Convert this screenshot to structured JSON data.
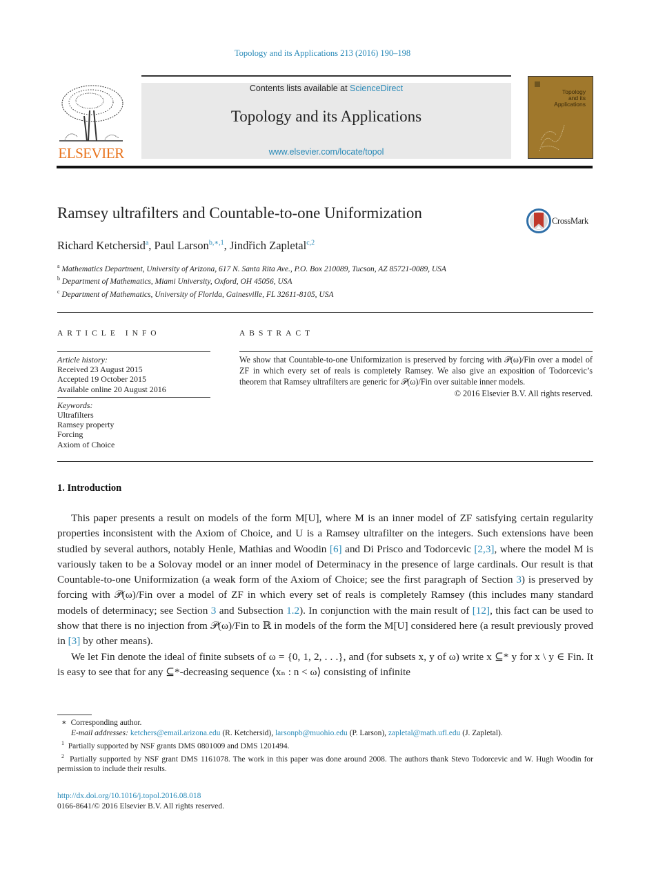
{
  "header": {
    "journal_ref": "Topology and its Applications 213 (2016) 190–198",
    "contents_prefix": "Contents lists available at ",
    "contents_link": "ScienceDirect",
    "journal_name": "Topology and its Applications",
    "journal_url": "www.elsevier.com/locate/topol",
    "publisher_logo": "ELSEVIER",
    "cover_title_lines": [
      "Topology",
      "and its",
      "Applications"
    ]
  },
  "article": {
    "title": "Ramsey ultrafilters and Countable-to-one Uniformization",
    "crossmark_label": "CrossMark",
    "authors": [
      {
        "name": "Richard Ketchersid",
        "marks": "a"
      },
      {
        "name": "Paul Larson",
        "marks": "b,∗,1"
      },
      {
        "name": "Jindřich Zapletal",
        "marks": "c,2"
      }
    ],
    "affiliations": [
      {
        "mark": "a",
        "text": "Mathematics Department, University of Arizona, 617 N. Santa Rita Ave., P.O. Box 210089, Tucson, AZ 85721-0089, USA"
      },
      {
        "mark": "b",
        "text": "Department of Mathematics, Miami University, Oxford, OH 45056, USA"
      },
      {
        "mark": "c",
        "text": "Department of Mathematics, University of Florida, Gainesville, FL 32611-8105, USA"
      }
    ]
  },
  "article_info": {
    "heading": "ARTICLE INFO",
    "history_label": "Article history:",
    "history": [
      "Received 23 August 2015",
      "Accepted 19 October 2015",
      "Available online 20 August 2016"
    ],
    "keywords_label": "Keywords:",
    "keywords": [
      "Ultrafilters",
      "Ramsey property",
      "Forcing",
      "Axiom of Choice"
    ]
  },
  "abstract": {
    "heading": "ABSTRACT",
    "text": "We show that Countable-to-one Uniformization is preserved by forcing with 𝒫(ω)/Fin over a model of ZF in which every set of reals is completely Ramsey. We also give an exposition of Todorcevic’s theorem that Ramsey ultrafilters are generic for 𝒫(ω)/Fin over suitable inner models.",
    "copyright": "© 2016 Elsevier B.V. All rights reserved."
  },
  "section": {
    "heading": "1.  Introduction",
    "p1": [
      "This paper presents a result on models of the form M[U], where M is an inner model of ZF satisfying certain regularity properties inconsistent with the Axiom of Choice, and U is a Ramsey ultrafilter on the integers. Such extensions have been studied by several authors, notably Henle, Mathias and Woodin ",
      "[6]",
      " and Di Prisco and Todorcevic ",
      "[2,3]",
      ", where the model M is variously taken to be a Solovay model or an inner model of Determinacy in the presence of large cardinals. Our result is that Countable-to-one Uniformization (a weak form of the Axiom of Choice; see the first paragraph of Section ",
      "3",
      ") is preserved by forcing with 𝒫(ω)/Fin over a model of ZF in which every set of reals is completely Ramsey (this includes many standard models of determinacy; see Section ",
      "3",
      " and Subsection ",
      "1.2",
      "). In conjunction with the main result of ",
      "[12]",
      ", this fact can be used to show that there is no injection from 𝒫(ω)/Fin to ℝ in models of the form the M[U] considered here (a result previously proved in ",
      "[3]",
      " by other means)."
    ],
    "p2": "We let Fin denote the ideal of finite subsets of ω = {0, 1, 2, . . .}, and (for subsets x, y of ω) write x ⊆* y for x \\ y ∈ Fin. It is easy to see that for any ⊆*-decreasing sequence ⟨xₙ : n < ω⟩ consisting of infinite"
  },
  "footnotes": {
    "corresponding": "Corresponding author.",
    "corresponding_mark": "∗",
    "email_label": "E-mail addresses:",
    "emails": [
      {
        "address": "ketchers@email.arizona.edu",
        "who": " (R. Ketchersid), "
      },
      {
        "address": "larsonpb@muohio.edu",
        "who": " (P. Larson), "
      },
      {
        "address": "zapletal@math.ufl.edu",
        "who": " (J. Zapletal)."
      }
    ],
    "fn1": {
      "mark": "1",
      "text": "Partially supported by NSF grants DMS 0801009 and DMS 1201494."
    },
    "fn2": {
      "mark": "2",
      "text": "Partially supported by NSF grant DMS 1161078. The work in this paper was done around 2008. The authors thank Stevo Todorcevic and W. Hugh Woodin for permission to include their results."
    }
  },
  "doi": {
    "link": "http://dx.doi.org/10.1016/j.topol.2016.08.018",
    "issn_line": "0166-8641/© 2016 Elsevier B.V. All rights reserved."
  }
}
